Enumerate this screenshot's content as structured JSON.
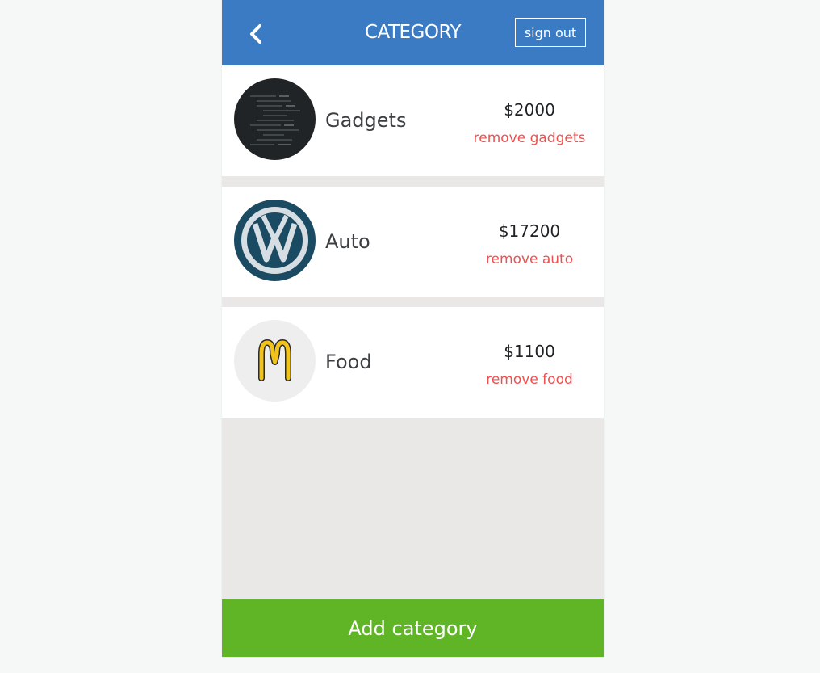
{
  "header": {
    "title": "CATEGORY",
    "back_icon": "chevron-left-icon",
    "signout_label": "sign out",
    "color": "#3b7bc4"
  },
  "categories": [
    {
      "name": "Gadgets",
      "amount": "$2000",
      "remove_label": "remove gadgets",
      "image": "code-screen-thumbnail"
    },
    {
      "name": "Auto",
      "amount": "$17200",
      "remove_label": "remove auto",
      "image": "vw-logo-thumbnail"
    },
    {
      "name": "Food",
      "amount": "$1100",
      "remove_label": "remove food",
      "image": "mcdonalds-logo-thumbnail"
    }
  ],
  "footer": {
    "add_label": "Add category",
    "color": "#5fb526"
  },
  "colors": {
    "remove": "#f15050",
    "page_bg": "#f6f8f7",
    "list_bg": "#e9e8e6"
  }
}
